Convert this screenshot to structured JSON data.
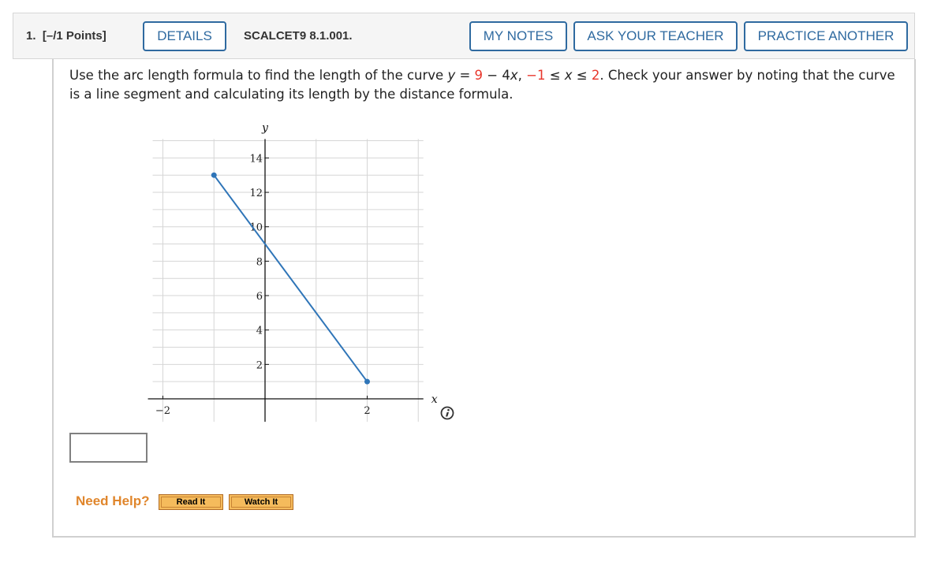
{
  "header": {
    "question_number": "1.",
    "points": "[–/1 Points]",
    "details_label": "DETAILS",
    "problem_code": "SCALCET9 8.1.001.",
    "my_notes_label": "MY NOTES",
    "ask_teacher_label": "ASK YOUR TEACHER",
    "practice_another_label": "PRACTICE ANOTHER"
  },
  "prompt": {
    "part1": "Use the arc length formula to find the length of the curve ",
    "y_var": "y",
    "equals": " = ",
    "nine": "9",
    "minus4": " − 4",
    "x_var": "x",
    "comma": ", ",
    "neg1": "−1",
    "leq1": " ≤ ",
    "x_var2": "x",
    "leq2": " ≤ ",
    "two": "2",
    "part2": ". Check your answer by noting that the curve is a line segment and calculating its length by the distance formula."
  },
  "chart_data": {
    "type": "line",
    "title": "",
    "xlabel": "x",
    "ylabel": "y",
    "xlim": [
      -2.2,
      3.1
    ],
    "ylim": [
      -0.6,
      15.1
    ],
    "grid": true,
    "x_ticks": [
      -2,
      2
    ],
    "x_tick_labels": [
      "−2",
      "2"
    ],
    "y_ticks": [
      2,
      4,
      6,
      8,
      10,
      12,
      14
    ],
    "y_tick_labels": [
      "2",
      "4",
      "6",
      "8",
      "10",
      "12",
      "14"
    ],
    "x_grid": [
      -2,
      -1,
      1,
      2,
      3
    ],
    "y_grid": [
      1,
      2,
      3,
      4,
      5,
      6,
      7,
      8,
      9,
      10,
      11,
      12,
      13,
      14,
      15
    ],
    "series": [
      {
        "name": "y = 9 − 4x",
        "x": [
          -1,
          2
        ],
        "y": [
          13,
          1
        ],
        "color": "#2f75b8",
        "endpoints": true
      }
    ]
  },
  "answer": {
    "value": ""
  },
  "help": {
    "need_help_label": "Need Help?",
    "read_it_label": "Read It",
    "watch_it_label": "Watch It"
  },
  "icons": {
    "info": "info-icon"
  }
}
